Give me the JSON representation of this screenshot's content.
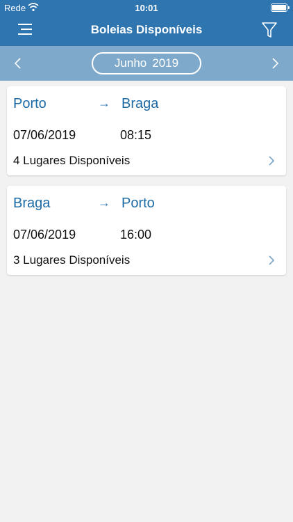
{
  "status_bar": {
    "carrier": "Rede",
    "time": "10:01",
    "wifi_icon": "wifi-icon",
    "battery_icon": "battery-icon"
  },
  "header": {
    "title": "Boleias Disponíveis",
    "menu_icon": "menu-icon",
    "filter_icon": "filter-icon"
  },
  "month_selector": {
    "month": "Junho",
    "year": "2019",
    "prev_icon": "chevron-left-icon",
    "next_icon": "chevron-right-icon"
  },
  "rides": [
    {
      "from": "Porto",
      "arrow": "→",
      "to": "Braga",
      "date": "07/06/2019",
      "time": "08:15",
      "seats": "4 Lugares Disponíveis"
    },
    {
      "from": "Braga",
      "arrow": "→",
      "to": "Porto",
      "date": "07/06/2019",
      "time": "16:00",
      "seats": "3 Lugares Disponíveis"
    }
  ],
  "colors": {
    "header": "#2f75b0",
    "month_bar": "#7fa9ca",
    "city_text": "#1d6aa5",
    "background": "#f2f2f2"
  }
}
